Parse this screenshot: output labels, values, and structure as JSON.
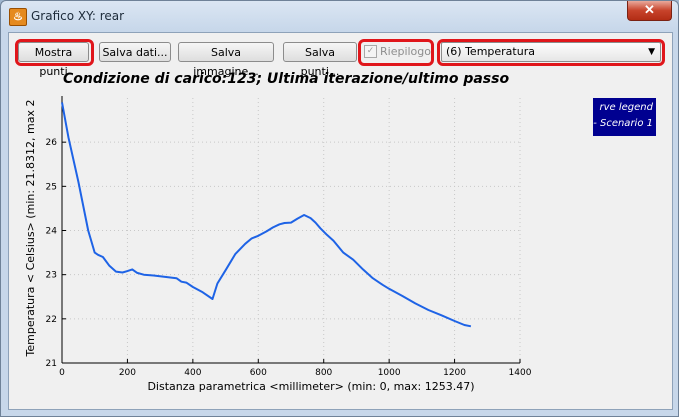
{
  "window": {
    "title": "Grafico XY: rear",
    "close_symbol": "✕"
  },
  "toolbar": {
    "show_points": "Mostra punti",
    "save_data": "Salva dati...",
    "save_image": "Salva immagine...",
    "save_points": "Salva punti...",
    "summary_label": "Riepilogo",
    "summary_checked": "✓",
    "result_select": "(6) Temperatura"
  },
  "legend": {
    "line1": "rve legend",
    "line2": "- Scenario 1"
  },
  "chart_data": {
    "type": "line",
    "title": "Condizione di carico:123; Ultima iterazione/ultimo passo",
    "xlabel": "Distanza parametrica <millimeter> (min: 0, max: 1253.47)",
    "ylabel": "Temperatura < Celsius> (min: 21.8312, max 2",
    "xlim": [
      0,
      1400
    ],
    "ylim": [
      21,
      27
    ],
    "xticks": [
      0,
      200,
      400,
      600,
      800,
      1000,
      1200,
      1400
    ],
    "yticks": [
      21,
      22,
      23,
      24,
      25,
      26
    ],
    "grid": true,
    "series": [
      {
        "name": "Scenario 1",
        "color": "#1e63e6",
        "x": [
          0,
          20,
          50,
          80,
          100,
          110,
          125,
          145,
          165,
          185,
          200,
          215,
          230,
          250,
          280,
          315,
          350,
          365,
          380,
          400,
          430,
          460,
          475,
          500,
          530,
          560,
          580,
          600,
          625,
          645,
          665,
          680,
          700,
          720,
          740,
          760,
          775,
          790,
          810,
          830,
          860,
          890,
          920,
          950,
          980,
          1000,
          1040,
          1080,
          1120,
          1160,
          1200,
          1230,
          1250
        ],
        "y": [
          26.9,
          26.1,
          25.1,
          24.0,
          23.5,
          23.45,
          23.4,
          23.2,
          23.07,
          23.05,
          23.08,
          23.12,
          23.04,
          23.0,
          22.98,
          22.95,
          22.92,
          22.84,
          22.82,
          22.72,
          22.6,
          22.45,
          22.8,
          23.1,
          23.47,
          23.7,
          23.82,
          23.88,
          23.98,
          24.07,
          24.14,
          24.17,
          24.18,
          24.27,
          24.35,
          24.28,
          24.18,
          24.05,
          23.9,
          23.77,
          23.5,
          23.34,
          23.12,
          22.92,
          22.77,
          22.68,
          22.52,
          22.35,
          22.2,
          22.08,
          21.95,
          21.86,
          21.83
        ]
      }
    ]
  }
}
